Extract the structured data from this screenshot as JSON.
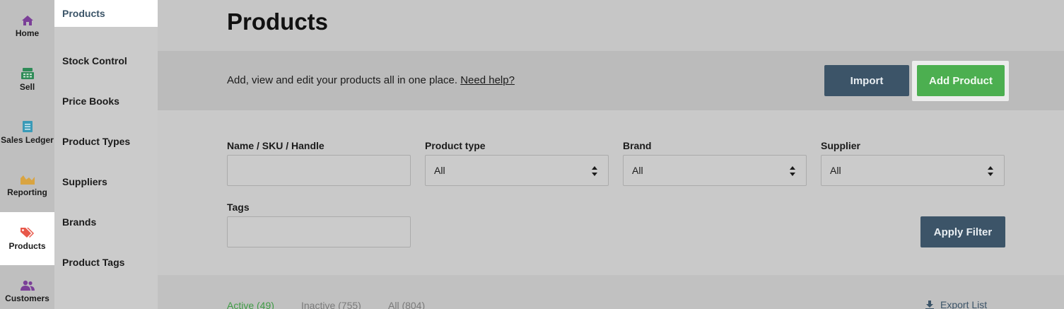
{
  "icon_nav": [
    {
      "label": "Home",
      "icon": "home-icon",
      "color": "#7b3f98"
    },
    {
      "label": "Sell",
      "icon": "register-icon",
      "color": "#2e8b57"
    },
    {
      "label": "Sales Ledger",
      "icon": "ledger-icon",
      "color": "#3a9ab7"
    },
    {
      "label": "Reporting",
      "icon": "chart-icon",
      "color": "#d9a441"
    },
    {
      "label": "Products",
      "icon": "tag-icon",
      "color": "#e8584a",
      "active": true
    },
    {
      "label": "Customers",
      "icon": "customers-icon",
      "color": "#7b3f98"
    }
  ],
  "sub_nav": [
    {
      "label": "Products",
      "active": true
    },
    {
      "label": "Stock Control"
    },
    {
      "label": "Price Books"
    },
    {
      "label": "Product Types"
    },
    {
      "label": "Suppliers"
    },
    {
      "label": "Brands"
    },
    {
      "label": "Product Tags"
    }
  ],
  "page": {
    "title": "Products",
    "description": "Add, view and edit your products all in one place.",
    "help_link": "Need help?",
    "import_label": "Import",
    "add_product_label": "Add Product"
  },
  "filters": {
    "name_label": "Name / SKU / Handle",
    "name_value": "",
    "product_type_label": "Product type",
    "product_type_value": "All",
    "brand_label": "Brand",
    "brand_value": "All",
    "supplier_label": "Supplier",
    "supplier_value": "All",
    "tags_label": "Tags",
    "tags_value": "",
    "apply_label": "Apply Filter"
  },
  "list": {
    "tabs": [
      {
        "label": "Active (49)",
        "active": true
      },
      {
        "label": "Inactive (755)"
      },
      {
        "label": "All (804)"
      }
    ],
    "export_label": "Export List"
  },
  "colors": {
    "primary_button": "#3c5468",
    "add_button": "#4caf50",
    "active_tab": "#3f9b45"
  }
}
